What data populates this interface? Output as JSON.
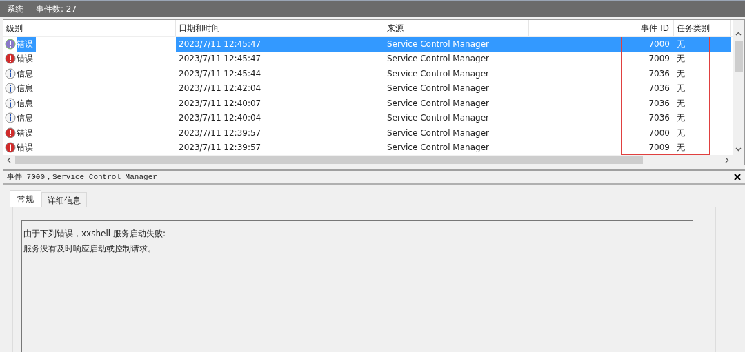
{
  "header": {
    "log_name": "系统",
    "event_count": "事件数: 27"
  },
  "table": {
    "columns": [
      {
        "label": "级别",
        "highlighted": false
      },
      {
        "label": "日期和时间",
        "highlighted": false
      },
      {
        "label": "来源",
        "highlighted": false
      },
      {
        "label": "事件 ID",
        "highlighted": true
      },
      {
        "label": "任务类别",
        "highlighted": true
      }
    ],
    "rows": [
      {
        "kind": "error",
        "level_text": "错误",
        "datetime": "2023/7/11 12:45:47",
        "source": "Service Control Manager",
        "event_id": "7000",
        "task": "无",
        "selected": true
      },
      {
        "kind": "error",
        "level_text": "错误",
        "datetime": "2023/7/11 12:45:47",
        "source": "Service Control Manager",
        "event_id": "7009",
        "task": "无",
        "selected": false
      },
      {
        "kind": "info",
        "level_text": "信息",
        "datetime": "2023/7/11 12:45:44",
        "source": "Service Control Manager",
        "event_id": "7036",
        "task": "无",
        "selected": false
      },
      {
        "kind": "info",
        "level_text": "信息",
        "datetime": "2023/7/11 12:42:04",
        "source": "Service Control Manager",
        "event_id": "7036",
        "task": "无",
        "selected": false
      },
      {
        "kind": "info",
        "level_text": "信息",
        "datetime": "2023/7/11 12:40:07",
        "source": "Service Control Manager",
        "event_id": "7036",
        "task": "无",
        "selected": false
      },
      {
        "kind": "info",
        "level_text": "信息",
        "datetime": "2023/7/11 12:40:04",
        "source": "Service Control Manager",
        "event_id": "7036",
        "task": "无",
        "selected": false
      },
      {
        "kind": "error",
        "level_text": "错误",
        "datetime": "2023/7/11 12:39:57",
        "source": "Service Control Manager",
        "event_id": "7000",
        "task": "无",
        "selected": false
      },
      {
        "kind": "error",
        "level_text": "错误",
        "datetime": "2023/7/11 12:39:57",
        "source": "Service Control Manager",
        "event_id": "7009",
        "task": "无",
        "selected": false
      }
    ]
  },
  "detail": {
    "title": "事件 7000，Service Control Manager",
    "tabs": [
      {
        "label": "常规",
        "selected": true
      },
      {
        "label": "详细信息",
        "selected": false
      }
    ],
    "message": [
      [
        {
          "text": "由于下列错误，",
          "highlighted": false
        },
        {
          "text": "xxshell 服务启动失败:",
          "highlighted": true
        }
      ],
      [
        {
          "text": "服务没有及时响应启动或控制请求。",
          "highlighted": false
        }
      ]
    ]
  }
}
